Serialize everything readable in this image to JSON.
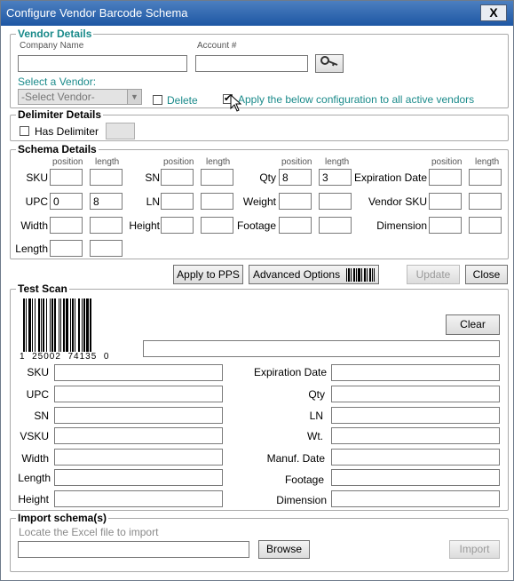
{
  "window": {
    "title": "Configure Vendor Barcode Schema",
    "close_glyph": "X"
  },
  "vendor": {
    "legend": "Vendor Details",
    "company_label": "Company Name",
    "account_label": "Account #",
    "company_value": "",
    "account_value": "",
    "select_label": "Select a Vendor:",
    "select_value": "-Select Vendor-",
    "delete_label": "Delete",
    "apply_all_label": "Apply the below configuration to all active vendors",
    "apply_all_checked": true
  },
  "delimiter": {
    "legend": "Delimiter Details",
    "has_label": "Has Delimiter"
  },
  "schema": {
    "legend": "Schema Details",
    "position_header": "position",
    "length_header": "length",
    "fields": {
      "sku": {
        "label": "SKU",
        "position": "",
        "length": ""
      },
      "sn": {
        "label": "SN",
        "position": "",
        "length": ""
      },
      "qty": {
        "label": "Qty",
        "position": "8",
        "length": "3"
      },
      "exp": {
        "label": "Expiration Date",
        "position": "",
        "length": ""
      },
      "upc": {
        "label": "UPC",
        "position": "0",
        "length": "8"
      },
      "ln": {
        "label": "LN",
        "position": "",
        "length": ""
      },
      "weight": {
        "label": "Weight",
        "position": "",
        "length": ""
      },
      "vsku": {
        "label": "Vendor SKU",
        "position": "",
        "length": ""
      },
      "width": {
        "label": "Width",
        "position": "",
        "length": ""
      },
      "height": {
        "label": "Height",
        "position": "",
        "length": ""
      },
      "footage": {
        "label": "Footage",
        "position": "",
        "length": ""
      },
      "dimension": {
        "label": "Dimension",
        "position": "",
        "length": ""
      },
      "length": {
        "label": "Length",
        "position": "",
        "length": ""
      }
    }
  },
  "actions": {
    "apply_pps": "Apply to PPS",
    "advanced": "Advanced Options",
    "update": "Update",
    "close": "Close"
  },
  "test_scan": {
    "legend": "Test Scan",
    "barcode_digits": "1  25002  74135  0",
    "clear": "Clear",
    "scan_value": "",
    "left_labels": [
      "SKU",
      "UPC",
      "SN",
      "VSKU",
      "Width",
      "Length",
      "Height"
    ],
    "right_labels": [
      "Expiration Date",
      "Qty",
      "LN",
      "Wt.",
      "Manuf. Date",
      "Footage",
      "Dimension"
    ]
  },
  "import": {
    "legend": "Import schema(s)",
    "hint": "Locate the Excel file to import",
    "file_value": "",
    "browse": "Browse",
    "import": "Import"
  }
}
